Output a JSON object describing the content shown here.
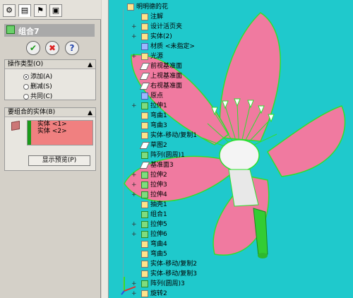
{
  "left_panel": {
    "tabs": [
      "feature-manager-icon",
      "property-manager-icon",
      "configuration-icon",
      "display-icon"
    ],
    "feature_title": "组合7",
    "buttons": {
      "ok": "✔",
      "cancel": "✖",
      "help": "?"
    },
    "operation_type": {
      "header": "操作类型(O)",
      "options": [
        "添加(A)",
        "删减(S)",
        "共同(C)"
      ],
      "selected": "添加(A)"
    },
    "bodies_to_combine": {
      "header": "要组合的实体(B)",
      "items": [
        "实体 <1>",
        "实体 <2>"
      ],
      "preview_button": "显示预览(P)"
    }
  },
  "tree": {
    "root": "明明德的花",
    "items": [
      "注解",
      "设计活页夹",
      "实体(2)",
      "材质 <未指定>",
      "光源",
      "前视基准面",
      "上视基准面",
      "右视基准面",
      "原点",
      "拉伸1",
      "弯曲1",
      "弯曲3",
      "实体-移动/复制1",
      "草图2",
      "阵列(圆周)1",
      "基准面3",
      "拉伸2",
      "拉伸3",
      "拉伸4",
      "抽壳1",
      "组合1",
      "拉伸5",
      "拉伸6",
      "弯曲4",
      "弯曲5",
      "实体-移动/复制2",
      "实体-移动/复制3",
      "阵列(圆周)3",
      "旋转2"
    ]
  },
  "colors": {
    "viewport_bg": "#1fc9cc",
    "petal": "#f07aa0",
    "edge": "#2ee02e",
    "stem": "#33cc33"
  }
}
